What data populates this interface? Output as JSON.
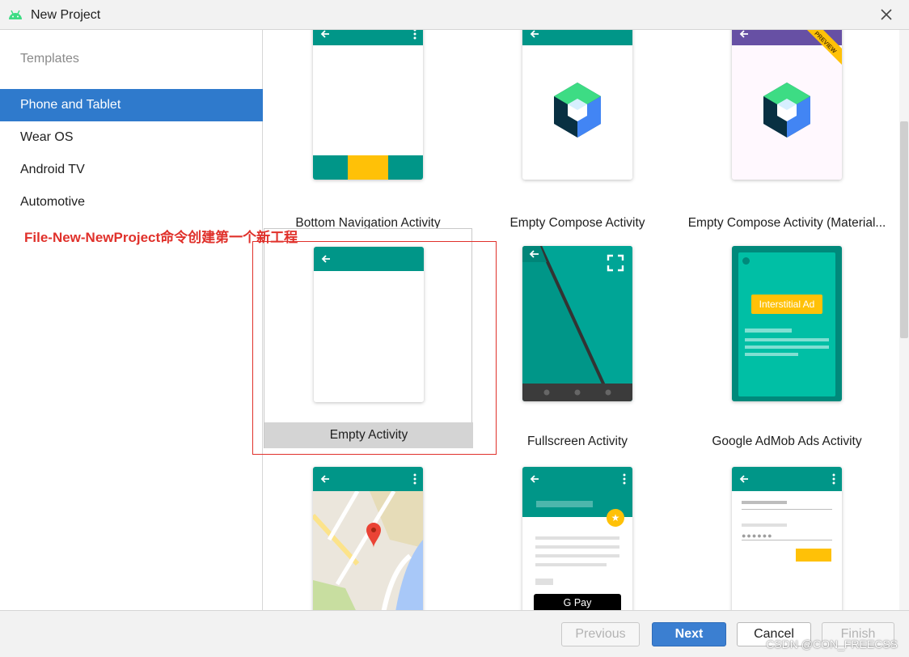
{
  "window": {
    "title": "New Project"
  },
  "sidebar": {
    "heading": "Templates",
    "items": [
      {
        "label": "Phone and Tablet",
        "selected": true
      },
      {
        "label": "Wear OS"
      },
      {
        "label": "Android TV"
      },
      {
        "label": "Automotive"
      }
    ]
  },
  "templates": [
    {
      "label": "Bottom Navigation Activity",
      "icon": "bottom-navigation-preview"
    },
    {
      "label": "Empty Compose Activity",
      "icon": "jetpack-compose-logo"
    },
    {
      "label": "Empty Compose Activity (Material...",
      "icon": "jetpack-compose-logo",
      "badge": "PREVIEW"
    },
    {
      "label": "Empty Activity",
      "icon": "empty-activity-preview",
      "selected": true
    },
    {
      "label": "Fullscreen Activity",
      "icon": "fullscreen-preview"
    },
    {
      "label": "Google AdMob Ads Activity",
      "icon": "admob-preview",
      "ad_text": "Interstitial Ad"
    },
    {
      "label": "",
      "icon": "google-maps-preview"
    },
    {
      "label": "",
      "icon": "google-pay-preview",
      "pay_text": "G Pay"
    },
    {
      "label": "",
      "icon": "login-form-preview"
    }
  ],
  "annotation": {
    "text": "File-New-NewProject命令创建第一个新工程"
  },
  "footer": {
    "previous": "Previous",
    "next": "Next",
    "cancel": "Cancel",
    "finish": "Finish"
  },
  "watermark": "CSDN @CON_FREECSS",
  "colors": {
    "accent": "#2f7acc",
    "teal": "#009688",
    "annotation": "#e0312b",
    "amber": "#ffc107"
  }
}
